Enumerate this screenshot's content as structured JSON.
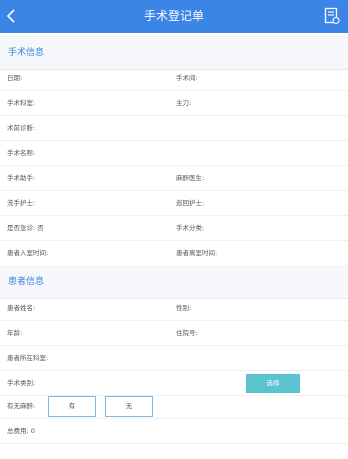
{
  "header": {
    "title": "手术登记单",
    "back_icon": "chevron-left-icon",
    "doc_icon": "document-icon"
  },
  "surgery": {
    "section_title": "手术信息",
    "date_label": "日期:",
    "room_label": "手术间:",
    "dept_label": "手术科室:",
    "surgeon_label": "主刀:",
    "pre_diag_label": "术前诊断:",
    "name_label": "手术名称:",
    "assistant_label": "手术助手:",
    "anesth_label": "麻醉医生:",
    "scrub_label": "洗手护士:",
    "circ_label": "巡回护士:",
    "emergency_label": "是否急诊: 否",
    "category_label": "手术分类:",
    "in_time_label": "患者入室时间:",
    "out_time_label": "患者离室时间:"
  },
  "patient": {
    "section_title": "患者信息",
    "name_label": "患者姓名:",
    "gender_label": "性别:",
    "age_label": "年龄:",
    "admission_label": "住院号:",
    "ward_label": "患者所在科室:",
    "type_label": "手术类别:",
    "select_button": "选择",
    "anesthesia_label": "有无麻醉:",
    "yes_label": "有",
    "no_label": "无",
    "total_label": "总费用: 0"
  }
}
